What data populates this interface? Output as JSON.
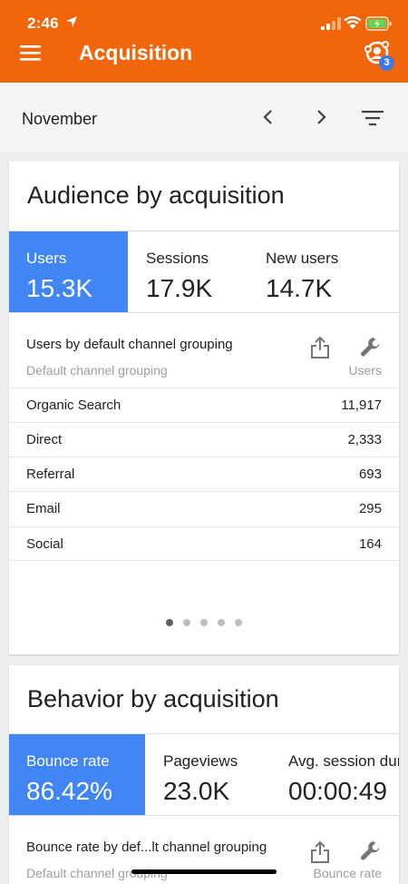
{
  "status_bar": {
    "time": "2:46"
  },
  "app_bar": {
    "title": "Acquisition",
    "account_badge": "3"
  },
  "date_bar": {
    "label": "November"
  },
  "audience_card": {
    "title": "Audience by acquisition",
    "metrics": [
      {
        "label": "Users",
        "value": "15.3K"
      },
      {
        "label": "Sessions",
        "value": "17.9K"
      },
      {
        "label": "New users",
        "value": "14.7K"
      }
    ],
    "table_title": "Users by default channel grouping",
    "column_left": "Default channel grouping",
    "column_right": "Users",
    "rows": [
      {
        "name": "Organic Search",
        "value": "11,917"
      },
      {
        "name": "Direct",
        "value": "2,333"
      },
      {
        "name": "Referral",
        "value": "693"
      },
      {
        "name": "Email",
        "value": "295"
      },
      {
        "name": "Social",
        "value": "164"
      }
    ],
    "page_count": 5,
    "current_page": 1
  },
  "behavior_card": {
    "title": "Behavior by acquisition",
    "metrics": [
      {
        "label": "Bounce rate",
        "value": "86.42%"
      },
      {
        "label": "Pageviews",
        "value": "23.0K"
      },
      {
        "label": "Avg. session dur",
        "value": "00:00:49"
      }
    ],
    "table_title": "Bounce rate by def...lt channel grouping",
    "column_left": "Default channel grouping",
    "column_right": "Bounce rate"
  },
  "colors": {
    "app_bar": "#f1660a",
    "active_metric": "#4285f4",
    "badge": "#3f7be8"
  }
}
